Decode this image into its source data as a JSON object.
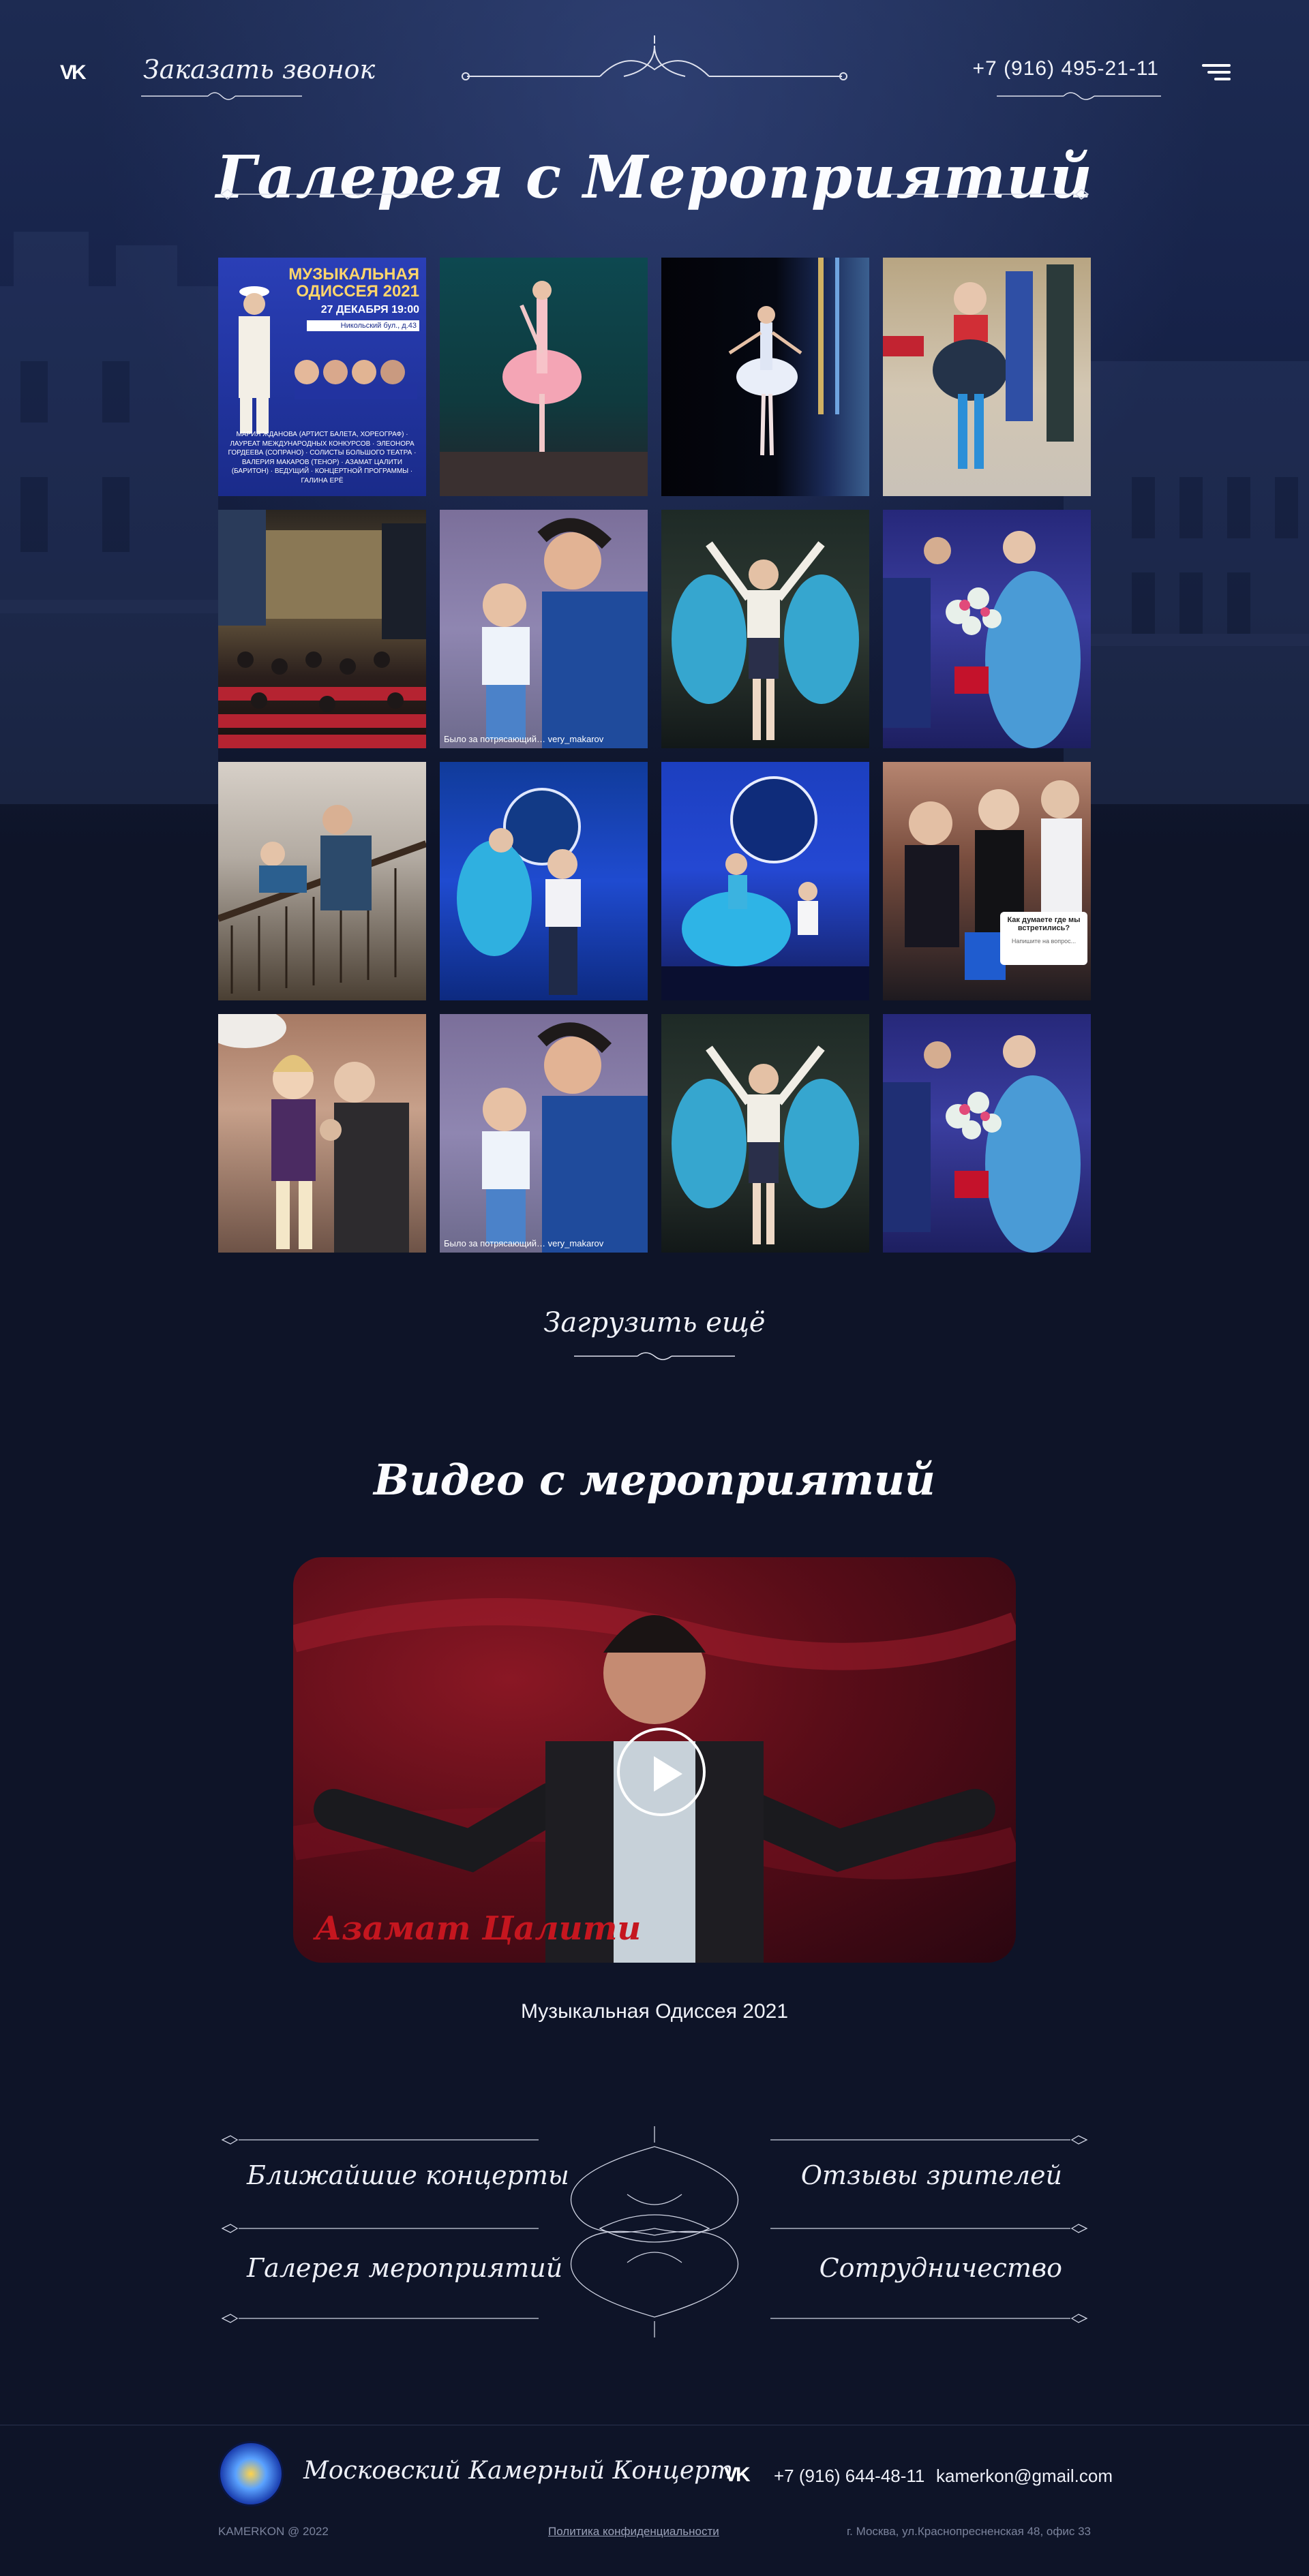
{
  "header": {
    "vk_label": "VK",
    "callback_label": "Заказать звонок",
    "phone": "+7 (916) 495-21-11"
  },
  "page_title": "Галерея с Мероприятий",
  "gallery": {
    "poster": {
      "title": "МУЗЫКАЛЬНАЯ ОДИССЕЯ 2021",
      "date": "27 ДЕКАБРЯ 19:00",
      "place": "Никольский бул., д.43",
      "cast": "МАРИЯ ЖДАНОВА (АРТИСТ БАЛЕТА, ХОРЕОГРАФ) · ЛАУРЕАТ МЕЖДУНАРОДНЫХ КОНКУРСОВ · ЭЛЕОНОРА ГОРДЕЕВА (СОПРАНО) · СОЛИСТЫ БОЛЬШОГО ТЕАТРА · ВАЛЕРИЯ МАКАРОВ (ТЕНОР) · АЗАМАТ ЦАЛИТИ (БАРИТОН) · ВЕДУЩИЙ · КОНЦЕРТНОЙ ПРОГРАММЫ · ГАЛИНА ЕРЁ"
    },
    "caption_1": "Было за потрясающий… very_makarov",
    "caption_2": "Было за потрясающий… very_makarov",
    "chat_q": "Как думаете где мы встретились?",
    "chat_a": "Напишите на вопрос..."
  },
  "load_more": "Загрузить ещё",
  "video": {
    "section_title": "Видео с мероприятий",
    "overlay_name": "Азамат Цалити",
    "caption": "Музыкальная Одиссея 2021"
  },
  "footer_nav": {
    "upcoming": "Ближайшие концерты",
    "reviews": "Отзывы зрителей",
    "gallery": "Галерея мероприятий",
    "cooperation": "Сотрудничество"
  },
  "footer": {
    "org_name": "Московский Камерный Концерт",
    "vk_label": "VK",
    "phone": "+7 (916) 644-48-11",
    "email": "kamerkon@gmail.com",
    "copyright": "KAMERKON @ 2022",
    "privacy": "Политика конфиденциальности",
    "address": "г. Москва, ул.Краснопресненская 48, офис 33"
  },
  "colors": {
    "background": "#0e1428",
    "header_bg": "#1d2b52",
    "text": "#f1f3fa",
    "video_name": "#c5161f"
  },
  "icons": [
    "vk-icon",
    "menu-icon",
    "play-icon",
    "flourish-ornament"
  ]
}
